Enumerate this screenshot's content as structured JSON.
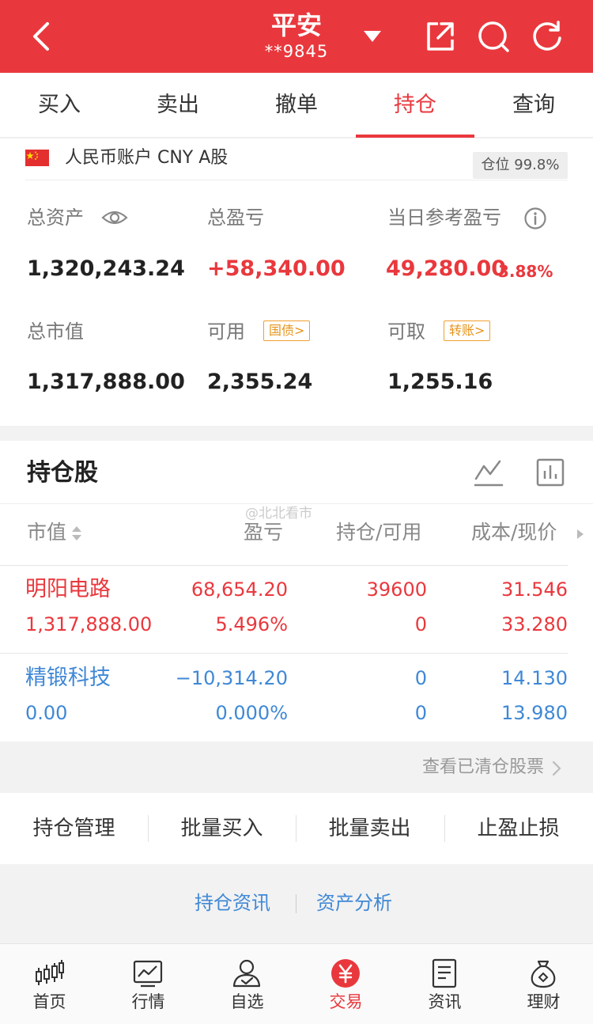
{
  "header": {
    "title": "平安",
    "account_masked": "**9845",
    "bg_color": "#e9383d"
  },
  "tabs": [
    {
      "label": "买入"
    },
    {
      "label": "卖出"
    },
    {
      "label": "撤单"
    },
    {
      "label": "持仓",
      "active": true
    },
    {
      "label": "查询"
    }
  ],
  "account": {
    "name": "人民币账户 CNY A股",
    "position_badge": "仓位 99.8%",
    "total_assets_label": "总资产",
    "total_assets": "1,320,243.24",
    "total_pl_label": "总盈亏",
    "total_pl": "+58,340.00",
    "day_pl_label": "当日参考盈亏",
    "day_pl": "49,280.00",
    "day_pl_pct": "3.88%",
    "market_value_label": "总市值",
    "market_value": "1,317,888.00",
    "available_label": "可用",
    "available_tag": "国债>",
    "available": "2,355.24",
    "withdrawable_label": "可取",
    "withdrawable_tag": "转账>",
    "withdrawable": "1,255.16"
  },
  "holdings": {
    "title": "持仓股",
    "watermark": "@北北看市",
    "columns": [
      "市值",
      "盈亏",
      "持仓/可用",
      "成本/现价"
    ],
    "rows": [
      {
        "name": "明阳电路",
        "market_value": "1,317,888.00",
        "pl": "68,654.20",
        "pl_pct": "5.496%",
        "position": "39600",
        "available": "0",
        "cost": "31.546",
        "price": "33.280",
        "color": "#e9383d"
      },
      {
        "name": "精锻科技",
        "market_value": "0.00",
        "pl": "−10,314.20",
        "pl_pct": "0.000%",
        "position": "0",
        "available": "0",
        "cost": "14.130",
        "price": "13.980",
        "color": "#3f88d6"
      }
    ],
    "cleared_link": "查看已清仓股票"
  },
  "actions": [
    "持仓管理",
    "批量买入",
    "批量卖出",
    "止盈止损"
  ],
  "links": [
    "持仓资讯",
    "资产分析"
  ],
  "bottom_nav": [
    {
      "label": "首页",
      "icon": "candlestick-icon"
    },
    {
      "label": "行情",
      "icon": "chart-icon"
    },
    {
      "label": "自选",
      "icon": "person-check-icon"
    },
    {
      "label": "交易",
      "icon": "yuan-icon",
      "active": true
    },
    {
      "label": "资讯",
      "icon": "document-icon"
    },
    {
      "label": "理财",
      "icon": "money-bag-icon"
    }
  ]
}
